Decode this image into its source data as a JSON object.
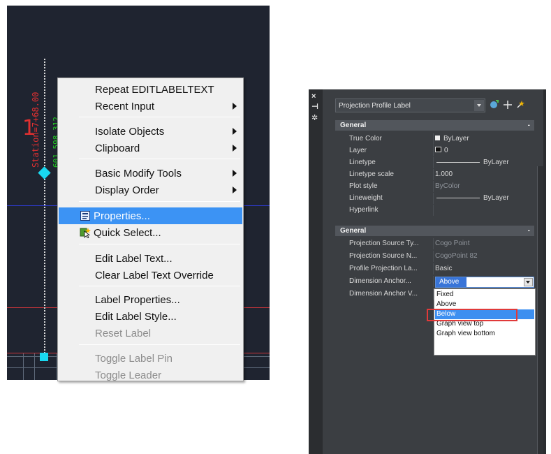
{
  "context_menu": {
    "items": [
      {
        "label": "Repeat EDITLABELTEXT",
        "submenu": false,
        "enabled": true
      },
      {
        "label": "Recent Input",
        "submenu": true,
        "enabled": true
      },
      {
        "label": "Isolate Objects",
        "submenu": true,
        "enabled": true
      },
      {
        "label": "Clipboard",
        "submenu": true,
        "enabled": true
      },
      {
        "label": "Basic Modify Tools",
        "submenu": true,
        "enabled": true
      },
      {
        "label": "Display Order",
        "submenu": true,
        "enabled": true
      },
      {
        "label": "Properties...",
        "submenu": false,
        "enabled": true,
        "highlighted": true,
        "icon": "properties-icon"
      },
      {
        "label": "Quick Select...",
        "submenu": false,
        "enabled": true,
        "icon": "quick-select-icon"
      },
      {
        "label": "Edit Label Text...",
        "submenu": false,
        "enabled": true
      },
      {
        "label": "Clear Label Text Override",
        "submenu": false,
        "enabled": true
      },
      {
        "label": "Label Properties...",
        "submenu": false,
        "enabled": true
      },
      {
        "label": "Edit Label Style...",
        "submenu": false,
        "enabled": true
      },
      {
        "label": "Reset Label",
        "submenu": false,
        "enabled": false
      },
      {
        "label": "Toggle Label Pin",
        "submenu": false,
        "enabled": false
      },
      {
        "label": "Toggle Leader",
        "submenu": false,
        "enabled": false
      }
    ],
    "highlight_color": "#3c93f4"
  },
  "drawing": {
    "station_label": "Station=7+68.00",
    "elevation_label": "601.598.312",
    "marker_glyph": "1",
    "background_color": "#1f2430"
  },
  "palette": {
    "object_type": "Projection Profile Label",
    "side_strip_icons": [
      "×",
      "⊣",
      "✲"
    ],
    "tool_icons": [
      "select-objects-icon",
      "pickadd-icon",
      "quick-select-icon"
    ],
    "categories": [
      {
        "title": "General",
        "collapse_glyph": "-",
        "rows": [
          {
            "name": "True Color",
            "value": "ByLayer",
            "kind": "color"
          },
          {
            "name": "Layer",
            "value": "0",
            "kind": "layer"
          },
          {
            "name": "Linetype",
            "value": "ByLayer",
            "kind": "line"
          },
          {
            "name": "Linetype scale",
            "value": "1.000",
            "kind": "text"
          },
          {
            "name": "Plot style",
            "value": "ByColor",
            "kind": "dim"
          },
          {
            "name": "Lineweight",
            "value": "ByLayer",
            "kind": "line"
          },
          {
            "name": "Hyperlink",
            "value": "",
            "kind": "text"
          }
        ]
      },
      {
        "title": "General",
        "collapse_glyph": "-",
        "rows": [
          {
            "name": "Projection Source Ty...",
            "value": "Cogo Point",
            "kind": "dim"
          },
          {
            "name": "Projection Source N...",
            "value": "CogoPoint 82",
            "kind": "dim"
          },
          {
            "name": "Profile Projection La...",
            "value": "Basic",
            "kind": "text"
          },
          {
            "name": "Dimension Anchor...",
            "value": "Above",
            "kind": "dropdown"
          },
          {
            "name": "Dimension Anchor V...",
            "value": "Fixed",
            "kind": "text"
          }
        ]
      }
    ],
    "dropdown": {
      "current": "Above",
      "options": [
        "Fixed",
        "Above",
        "Below",
        "Graph view top",
        "Graph view bottom"
      ],
      "selected_index": 2
    }
  }
}
